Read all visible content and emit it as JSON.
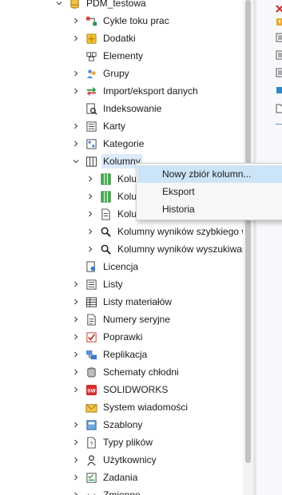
{
  "tree": {
    "root": {
      "label": "PDM_testowa",
      "icon": "database-icon"
    },
    "items": [
      {
        "label": "Cykle toku prac",
        "icon": "workflow-icon",
        "expander": "collapsed"
      },
      {
        "label": "Dodatki",
        "icon": "add-in-icon",
        "expander": "collapsed"
      },
      {
        "label": "Elementy",
        "icon": "items-icon",
        "expander": "none"
      },
      {
        "label": "Grupy",
        "icon": "groups-icon",
        "expander": "collapsed"
      },
      {
        "label": "Import/eksport danych",
        "icon": "import-export-icon",
        "expander": "collapsed"
      },
      {
        "label": "Indeksowanie",
        "icon": "indexing-icon",
        "expander": "none"
      },
      {
        "label": "Karty",
        "icon": "cards-icon",
        "expander": "collapsed"
      },
      {
        "label": "Kategorie",
        "icon": "categories-icon",
        "expander": "collapsed"
      },
      {
        "label": "Kolumny",
        "icon": "columns-icon",
        "expander": "expanded",
        "selected": true
      },
      {
        "label": "Kolumny",
        "icon": "column-set-icon",
        "expander": "collapsed",
        "indent": 1
      },
      {
        "label": "Kolumny",
        "icon": "column-set-icon",
        "expander": "collapsed",
        "indent": 1
      },
      {
        "label": "Kolumny",
        "icon": "document-icon",
        "expander": "collapsed",
        "indent": 1
      },
      {
        "label": "Kolumny wyników szybkiego wyszukiwania",
        "icon": "search-icon",
        "expander": "collapsed",
        "indent": 1
      },
      {
        "label": "Kolumny wyników wyszukiwania",
        "icon": "search-icon",
        "expander": "collapsed",
        "indent": 1
      },
      {
        "label": "Licencja",
        "icon": "license-icon",
        "expander": "none"
      },
      {
        "label": "Listy",
        "icon": "lists-icon",
        "expander": "collapsed"
      },
      {
        "label": "Listy materiałów",
        "icon": "bom-icon",
        "expander": "collapsed"
      },
      {
        "label": "Numery seryjne",
        "icon": "serial-numbers-icon",
        "expander": "collapsed"
      },
      {
        "label": "Poprawki",
        "icon": "revisions-icon",
        "expander": "collapsed"
      },
      {
        "label": "Replikacja",
        "icon": "replication-icon",
        "expander": "collapsed"
      },
      {
        "label": "Schematy chłodni",
        "icon": "cold-storage-icon",
        "expander": "collapsed"
      },
      {
        "label": "SOLIDWORKS",
        "icon": "solidworks-icon",
        "expander": "collapsed"
      },
      {
        "label": "System wiadomości",
        "icon": "message-system-icon",
        "expander": "none"
      },
      {
        "label": "Szablony",
        "icon": "templates-icon",
        "expander": "collapsed"
      },
      {
        "label": "Typy plików",
        "icon": "file-types-icon",
        "expander": "collapsed"
      },
      {
        "label": "Użytkownicy",
        "icon": "users-icon",
        "expander": "collapsed"
      },
      {
        "label": "Zadania",
        "icon": "tasks-icon",
        "expander": "collapsed"
      },
      {
        "label": "Zmienne",
        "icon": "variables-icon",
        "expander": "collapsed"
      }
    ]
  },
  "context_menu": {
    "items": [
      {
        "label": "Nowy zbiór kolumn...",
        "highlighted": true
      },
      {
        "label": "Eksport",
        "highlighted": false
      },
      {
        "label": "Historia",
        "highlighted": false
      }
    ]
  },
  "colors": {
    "selection": "#dceafc",
    "menu_highlight": "#cce4f7",
    "menu_background": "#f7f7f7"
  }
}
